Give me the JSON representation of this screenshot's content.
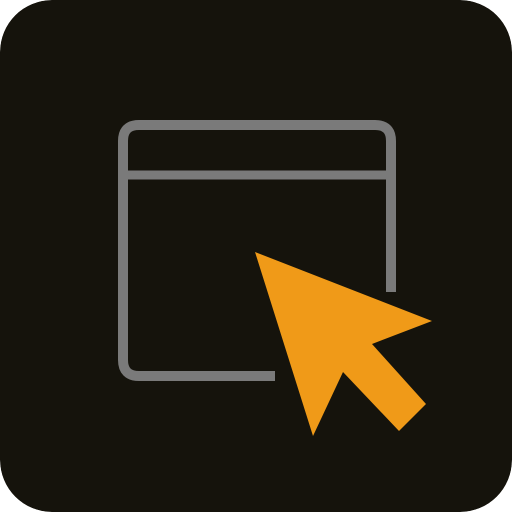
{
  "app_icon": {
    "name": "window-with-cursor",
    "colors": {
      "background": "#15130c",
      "window_outline": "#7a7a7a",
      "cursor_fill": "#f09a18"
    },
    "icons": {
      "window": "browser-window-icon",
      "cursor": "mouse-pointer-icon"
    }
  }
}
